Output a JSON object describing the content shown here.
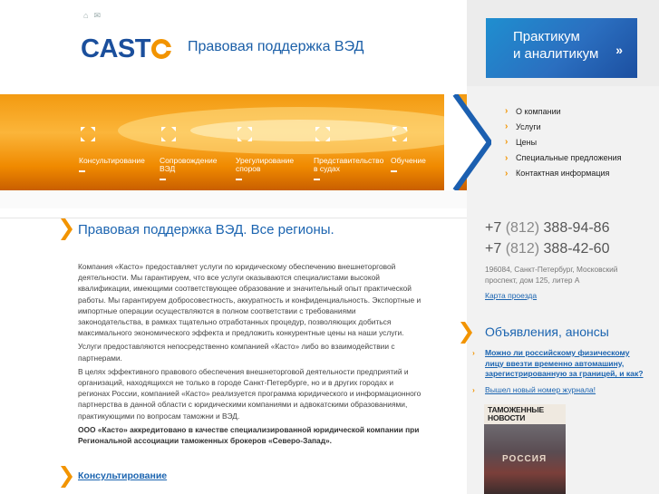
{
  "header": {
    "logo_text": "CAST",
    "tagline": "Правовая поддержка ВЭД",
    "icons": [
      "home-icon",
      "mail-icon"
    ]
  },
  "banner": {
    "line1": "Практикум",
    "line2": "и аналитикум",
    "arrow": "»"
  },
  "hero": {
    "items": [
      {
        "line1": "Консультирование",
        "line2": ""
      },
      {
        "line1": "Сопровождение",
        "line2": "ВЭД"
      },
      {
        "line1": "Урегулирование",
        "line2": "споров"
      },
      {
        "line1": "Представительство",
        "line2": "в судах"
      },
      {
        "line1": "Обучение",
        "line2": ""
      }
    ]
  },
  "nav": {
    "items": [
      {
        "label": "О компании"
      },
      {
        "label": "Услуги"
      },
      {
        "label": "Цены"
      },
      {
        "label": "Специальные предложения"
      },
      {
        "label": "Контактная информация"
      }
    ]
  },
  "main": {
    "title": "Правовая поддержка ВЭД. Все регионы.",
    "paragraphs": [
      "Компания «Касто» предоставляет услуги по юридическому обеспечению внешнеторговой деятельности. Мы гарантируем, что все услуги оказываются специалистами высокой квалификации, имеющими соответствующее образование и значительный опыт практической работы. Мы гарантируем добросовестность, аккуратность и конфиденциальность. Экспортные и импортные операции осуществляются в полном соответствии с требованиями законодательства, в рамках тщательно отработанных процедур, позволяющих добиться максимального экономического эффекта и предложить конкурентные цены на наши услуги.",
      "Услуги предоставляются непосредственно компанией «Касто» либо во взаимодействии с партнерами.",
      "В целях эффективного правового обеспечения внешнеторговой деятельности предприятий и организаций, находящихся не только в городе Санкт-Петербурге, но и в других городах и регионах России, компанией «Касто» реализуется программа юридического и информационного партнерства в данной области с юридическими компаниями и адвокатскими образованиями, практикующими по вопросам таможни и ВЭД."
    ],
    "bold_paragraph": "ООО «Касто» аккредитовано в качестве специализированной юридической компании при Региональной ассоциации таможенных брокеров «Северо-Запад».",
    "section_link": "Консультирование"
  },
  "contacts": {
    "phone1_prefix": "+7",
    "phone1_code": "(812)",
    "phone1_number": "388-94-86",
    "phone2_prefix": "+7",
    "phone2_code": "(812)",
    "phone2_number": "388-42-60",
    "address": "196084, Санкт-Петербург, Московский проспект, дом 125, литер А",
    "map_link": "Карта проезда"
  },
  "news": {
    "title": "Объявления, анонсы",
    "items": [
      {
        "text": "Можно ли российскому физическому лицу ввезти временно автомашину, зарегистрированную за границей, и как?"
      },
      {
        "text": "Вышел новый номер журнала!"
      }
    ],
    "magazine_title": "ТАМОЖЕННЫЕ НОВОСТИ",
    "magazine_caption": "РОССИЯ"
  },
  "colors": {
    "brand_blue": "#1b4f9c",
    "link_blue": "#1b64b0",
    "accent_orange": "#f29400"
  }
}
